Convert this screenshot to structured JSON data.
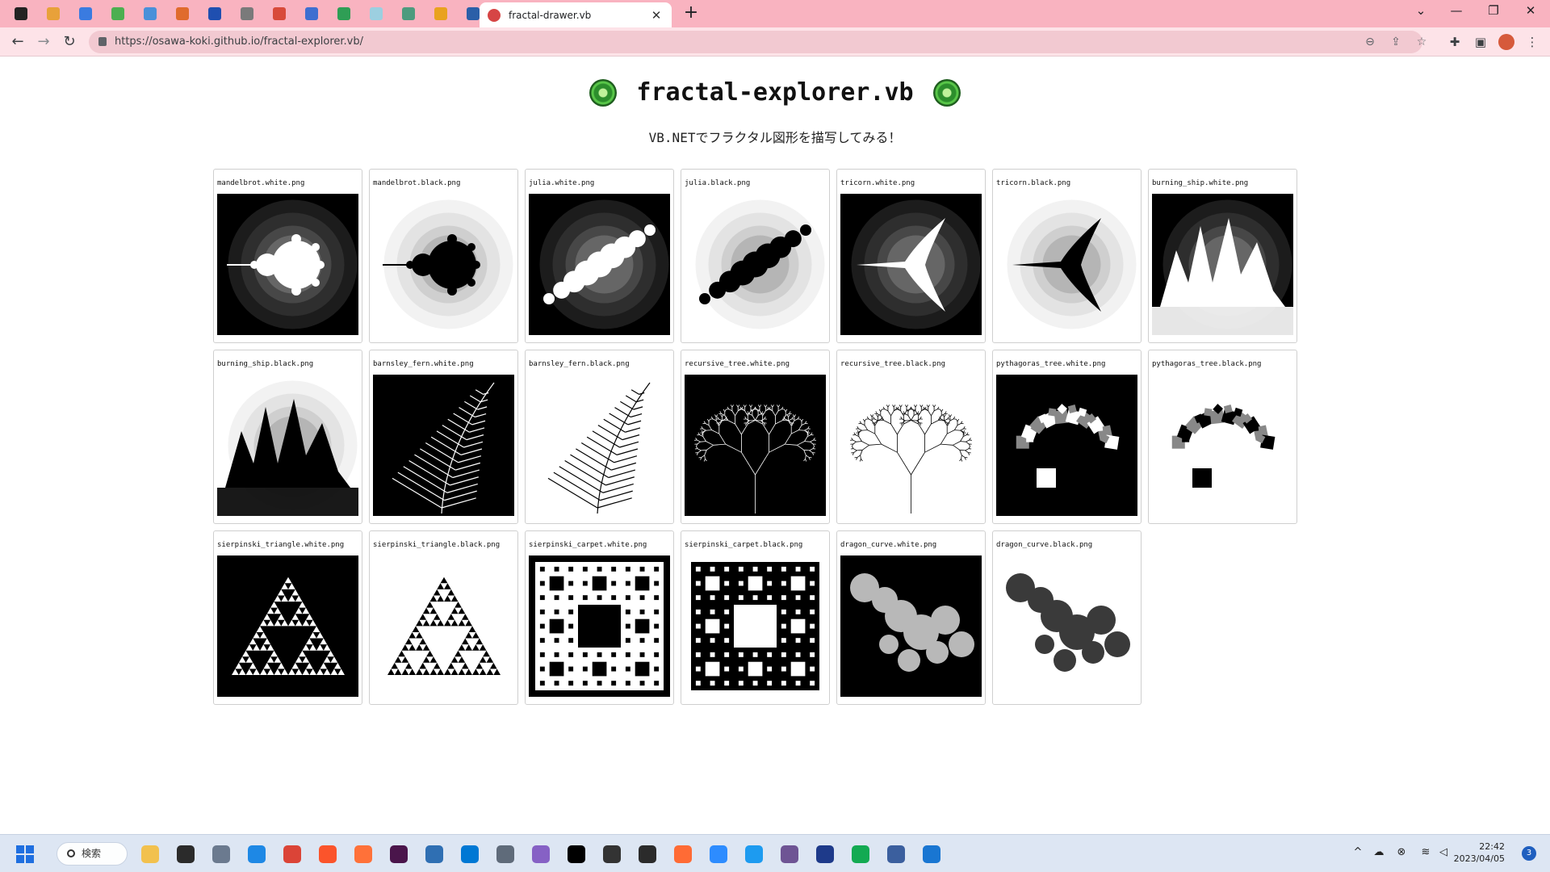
{
  "browser": {
    "tab_title": "fractal-drawer.vb",
    "new_tab": "+",
    "url": "https://osawa-koki.github.io/fractal-explorer.vb/",
    "pinned_tab_colors": [
      "#222222",
      "#e8a13a",
      "#3a7be0",
      "#4caf50",
      "#4a90d9",
      "#e06b2d",
      "#1f4fb0",
      "#7a7a7a",
      "#d84a3a",
      "#3e6fd0",
      "#2f9e55",
      "#9ccfe0",
      "#4d9b7e",
      "#e9a21f",
      "#2b5fa8"
    ],
    "window_controls": {
      "tab_search": "⌄",
      "minimize": "—",
      "restore": "❐",
      "close": "✕"
    }
  },
  "page": {
    "title": "fractal-explorer.vb",
    "subtitle_prefix": "VB.NET",
    "subtitle_rest": "でフラクタル図形を描写してみる！",
    "images": [
      {
        "label": "mandelbrot.white.png",
        "kind": "mandelbrot",
        "inverted": false
      },
      {
        "label": "mandelbrot.black.png",
        "kind": "mandelbrot",
        "inverted": true
      },
      {
        "label": "julia.white.png",
        "kind": "julia",
        "inverted": false
      },
      {
        "label": "julia.black.png",
        "kind": "julia",
        "inverted": true
      },
      {
        "label": "tricorn.white.png",
        "kind": "tricorn",
        "inverted": false
      },
      {
        "label": "tricorn.black.png",
        "kind": "tricorn",
        "inverted": true
      },
      {
        "label": "burning_ship.white.png",
        "kind": "burning_ship",
        "inverted": false
      },
      {
        "label": "burning_ship.black.png",
        "kind": "burning_ship",
        "inverted": true
      },
      {
        "label": "barnsley_fern.white.png",
        "kind": "fern",
        "inverted": false
      },
      {
        "label": "barnsley_fern.black.png",
        "kind": "fern",
        "inverted": true
      },
      {
        "label": "recursive_tree.white.png",
        "kind": "tree",
        "inverted": false
      },
      {
        "label": "recursive_tree.black.png",
        "kind": "tree",
        "inverted": true
      },
      {
        "label": "pythagoras_tree.white.png",
        "kind": "pythagoras",
        "inverted": false
      },
      {
        "label": "pythagoras_tree.black.png",
        "kind": "pythagoras",
        "inverted": true
      },
      {
        "label": "sierpinski_triangle.white.png",
        "kind": "sierpinski_triangle",
        "inverted": false
      },
      {
        "label": "sierpinski_triangle.black.png",
        "kind": "sierpinski_triangle",
        "inverted": true
      },
      {
        "label": "sierpinski_carpet.white.png",
        "kind": "sierpinski_carpet",
        "inverted": false
      },
      {
        "label": "sierpinski_carpet.black.png",
        "kind": "sierpinski_carpet",
        "inverted": true
      },
      {
        "label": "dragon_curve.white.png",
        "kind": "dragon",
        "inverted": false
      },
      {
        "label": "dragon_curve.black.png",
        "kind": "dragon",
        "inverted": true
      }
    ]
  },
  "taskbar": {
    "search_label": "検索",
    "app_colors": [
      "#f2c14e",
      "#2b2b2b",
      "#6b7a8f",
      "#1e88e5",
      "#db4437",
      "#fb542b",
      "#ff7139",
      "#4a154b",
      "#2f6fb3",
      "#0078d4",
      "#5f6b7a",
      "#8661c5",
      "#000000",
      "#333333",
      "#2b2b2b",
      "#ff6b35",
      "#2d8cff",
      "#1d9bf0",
      "#6e5494",
      "#1e3a8a",
      "#13aa52",
      "#3b5f9e",
      "#1976d2"
    ],
    "tray_icons": {
      "chevron": "^",
      "wifi": "≋",
      "volume": "◁"
    },
    "time": "22:42",
    "date": "2023/04/05",
    "notification_count": "3"
  }
}
